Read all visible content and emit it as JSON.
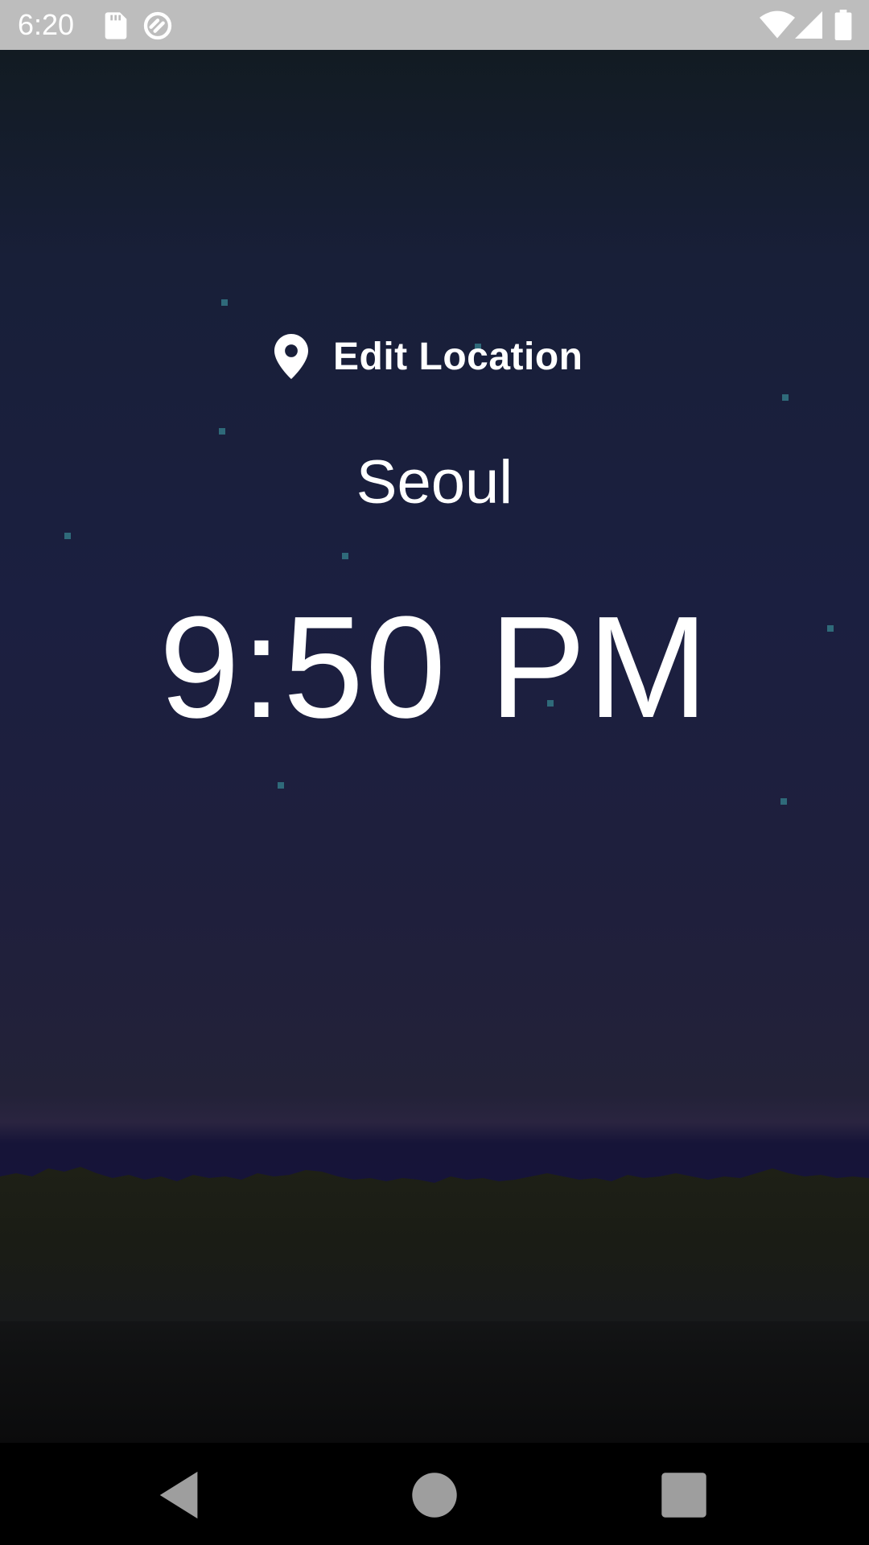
{
  "status_bar": {
    "time": "6:20",
    "left_icons": [
      "sd-card-icon",
      "sync-icon"
    ],
    "right_icons": [
      "wifi-icon",
      "cellular-signal-icon",
      "battery-icon"
    ]
  },
  "location": {
    "edit_label": "Edit Location",
    "icon": "location-pin-icon",
    "city": "Seoul",
    "time": "9:50 PM"
  },
  "colors": {
    "status_bar": "#bdbdbd",
    "sky_top": "#121b22",
    "sky_mid": "#1b1f40",
    "horizon": "#2a2440",
    "ground": "#181a1b",
    "star": "#2f6a7a",
    "text": "#ffffff"
  },
  "nav_bar": {
    "buttons": [
      "back-icon",
      "home-icon",
      "recents-icon"
    ]
  }
}
